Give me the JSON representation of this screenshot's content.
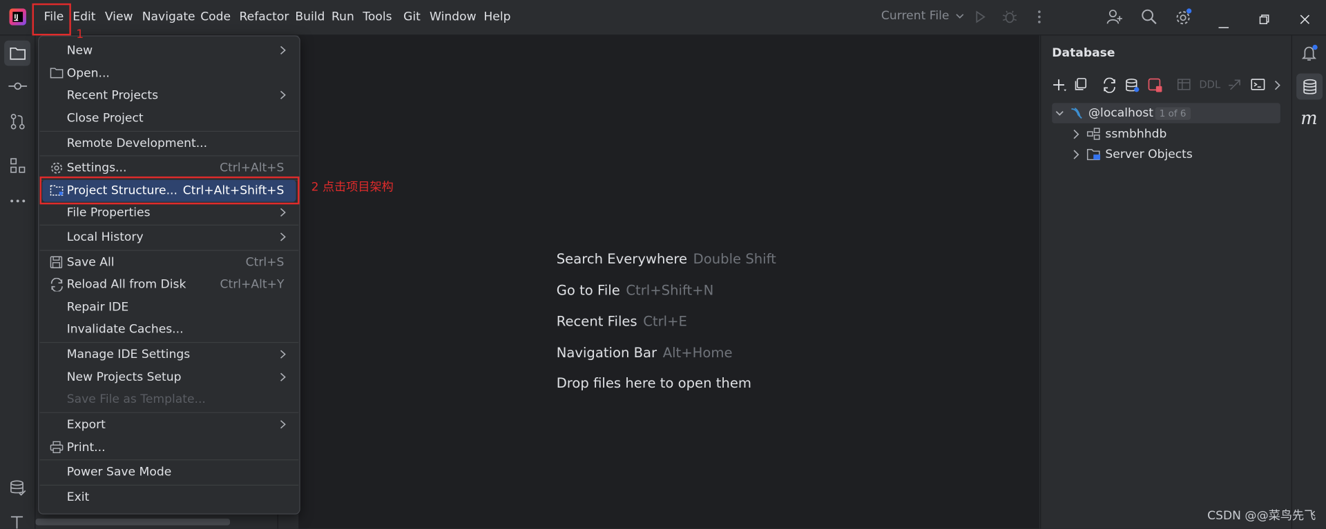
{
  "menubar": {
    "items": [
      "File",
      "Edit",
      "View",
      "Navigate",
      "Code",
      "Refactor",
      "Build",
      "Run",
      "Tools",
      "Git",
      "Window",
      "Help"
    ],
    "run_config": "Current File"
  },
  "file_menu": {
    "items": [
      {
        "label": "New",
        "shortcut": "",
        "submenu": true
      },
      {
        "label": "Open...",
        "shortcut": "",
        "icon": "folder-icon"
      },
      {
        "label": "Recent Projects",
        "shortcut": "",
        "submenu": true
      },
      {
        "label": "Close Project",
        "shortcut": ""
      },
      {
        "label": "Remote Development...",
        "shortcut": ""
      },
      {
        "label": "Settings...",
        "shortcut": "Ctrl+Alt+S",
        "icon": "gear-icon"
      },
      {
        "label": "Project Structure...",
        "shortcut": "Ctrl+Alt+Shift+S",
        "icon": "project-structure-icon",
        "active": true
      },
      {
        "label": "File Properties",
        "shortcut": "",
        "submenu": true
      },
      {
        "label": "Local History",
        "shortcut": "",
        "submenu": true
      },
      {
        "label": "Save All",
        "shortcut": "Ctrl+S",
        "icon": "save-icon"
      },
      {
        "label": "Reload All from Disk",
        "shortcut": "Ctrl+Alt+Y",
        "icon": "reload-icon"
      },
      {
        "label": "Repair IDE",
        "shortcut": ""
      },
      {
        "label": "Invalidate Caches...",
        "shortcut": ""
      },
      {
        "label": "Manage IDE Settings",
        "shortcut": "",
        "submenu": true
      },
      {
        "label": "New Projects Setup",
        "shortcut": "",
        "submenu": true
      },
      {
        "label": "Save File as Template...",
        "shortcut": "",
        "disabled": true
      },
      {
        "label": "Export",
        "shortcut": "",
        "submenu": true
      },
      {
        "label": "Print...",
        "shortcut": "",
        "icon": "print-icon"
      },
      {
        "label": "Power Save Mode",
        "shortcut": ""
      },
      {
        "label": "Exit",
        "shortcut": ""
      }
    ]
  },
  "annotations": {
    "step1": "1",
    "step2": "2 点击项目架构"
  },
  "editor_hints": [
    {
      "label": "Search Everywhere",
      "shortcut": "Double Shift"
    },
    {
      "label": "Go to File",
      "shortcut": "Ctrl+Shift+N"
    },
    {
      "label": "Recent Files",
      "shortcut": "Ctrl+E"
    },
    {
      "label": "Navigation Bar",
      "shortcut": "Alt+Home"
    },
    {
      "label": "Drop files here to open them",
      "shortcut": ""
    }
  ],
  "database": {
    "title": "Database",
    "toolbar_ddl": "DDL",
    "tree": [
      {
        "label": "@localhost",
        "badge": "1 of 6",
        "expanded": true,
        "level": 0
      },
      {
        "label": "ssmbhhdb",
        "expanded": false,
        "level": 1
      },
      {
        "label": "Server Objects",
        "expanded": false,
        "level": 1
      }
    ]
  },
  "watermark": "CSDN @@菜鸟先飞",
  "colors": {
    "accent_selection": "#2e436e",
    "annotation_red": "#e02b2b",
    "editor_bg": "#1e1f22",
    "panel_bg": "#2b2d30",
    "mysql_blue": "#3d8fd1"
  }
}
